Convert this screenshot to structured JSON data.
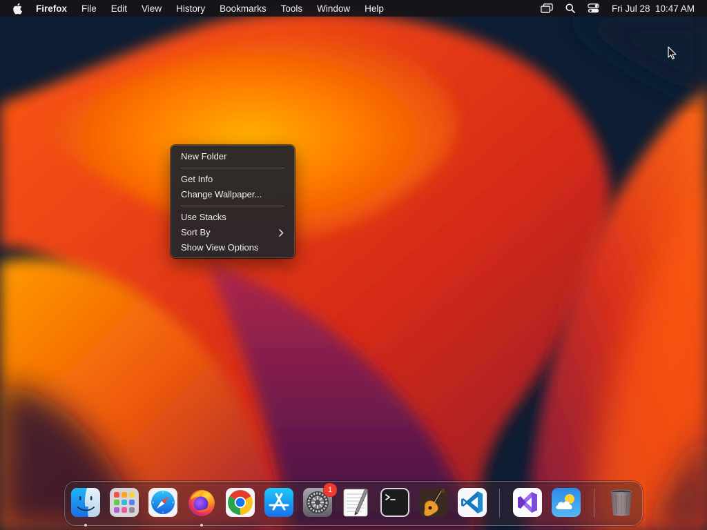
{
  "menubar": {
    "app_name": "Firefox",
    "items": [
      "File",
      "Edit",
      "View",
      "History",
      "Bookmarks",
      "Tools",
      "Window",
      "Help"
    ],
    "status_icons": [
      "screen-mirroring-icon",
      "spotlight-search-icon",
      "control-center-icon"
    ],
    "clock": "Fri Jul 28  10:47 AM"
  },
  "context_menu": {
    "groups": [
      [
        "New Folder"
      ],
      [
        "Get Info",
        "Change Wallpaper..."
      ],
      [
        "Use Stacks",
        "Sort By",
        "Show View Options"
      ]
    ],
    "submenu_item": "Sort By"
  },
  "dock": {
    "apps": [
      {
        "name": "Finder",
        "icon": "finder-icon",
        "running": true
      },
      {
        "name": "Launchpad",
        "icon": "launchpad-icon",
        "running": false
      },
      {
        "name": "Safari",
        "icon": "safari-icon",
        "running": false
      },
      {
        "name": "Firefox",
        "icon": "firefox-icon",
        "running": true
      },
      {
        "name": "Google Chrome",
        "icon": "chrome-icon",
        "running": false
      },
      {
        "name": "App Store",
        "icon": "app-store-icon",
        "running": false
      },
      {
        "name": "System Settings",
        "icon": "system-settings-icon",
        "running": false,
        "badge": "1"
      },
      {
        "name": "TextEdit",
        "icon": "textedit-icon",
        "running": false
      },
      {
        "name": "Terminal",
        "icon": "terminal-icon",
        "running": false
      },
      {
        "name": "GarageBand",
        "icon": "garageband-icon",
        "running": false
      },
      {
        "name": "Visual Studio Code",
        "icon": "vscode-icon",
        "running": false
      }
    ],
    "recent_apps": [
      {
        "name": "Visual Studio",
        "icon": "visual-studio-icon"
      },
      {
        "name": "Weather",
        "icon": "weather-icon"
      }
    ],
    "trash": {
      "name": "Trash",
      "icon": "trash-icon"
    }
  },
  "colors": {
    "menubar_bg": "#161418",
    "menu_bg": "#28262a",
    "badge": "#f0392f",
    "wallpaper_base": "#0c1d33",
    "wallpaper_orange": "#ff8a00"
  }
}
